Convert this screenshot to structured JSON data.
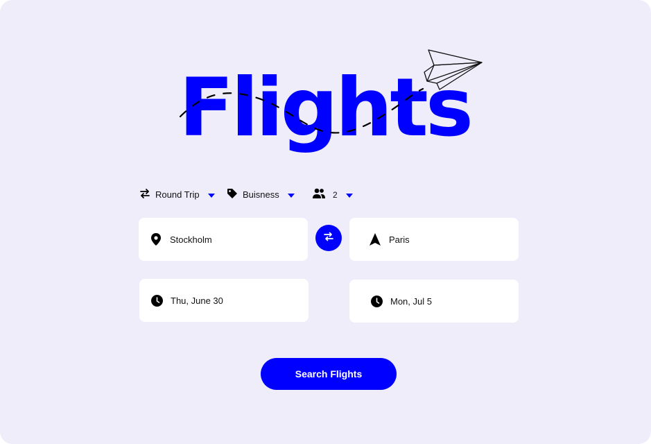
{
  "logo": {
    "title": "Flights"
  },
  "options": {
    "trip_type": "Round Trip",
    "cabin_class": "Buisness",
    "passengers": "2"
  },
  "fields": {
    "from": "Stockholm",
    "to": "Paris",
    "depart_date": "Thu, June 30",
    "return_date": "Mon, Jul 5"
  },
  "actions": {
    "search_label": "Search Flights"
  },
  "colors": {
    "accent": "#0000ff",
    "background": "#efedfa",
    "field_bg": "#ffffff",
    "icon": "#000000"
  },
  "icons": {
    "trip_type": "round-trip-arrows-icon",
    "cabin_class": "tag-icon",
    "passengers": "people-icon",
    "from": "location-pin-icon",
    "to": "navigation-arrow-icon",
    "depart": "clock-icon",
    "return": "clock-icon",
    "swap": "swap-arrows-icon",
    "dropdown": "caret-down-icon",
    "decoration": "paper-plane-icon"
  }
}
